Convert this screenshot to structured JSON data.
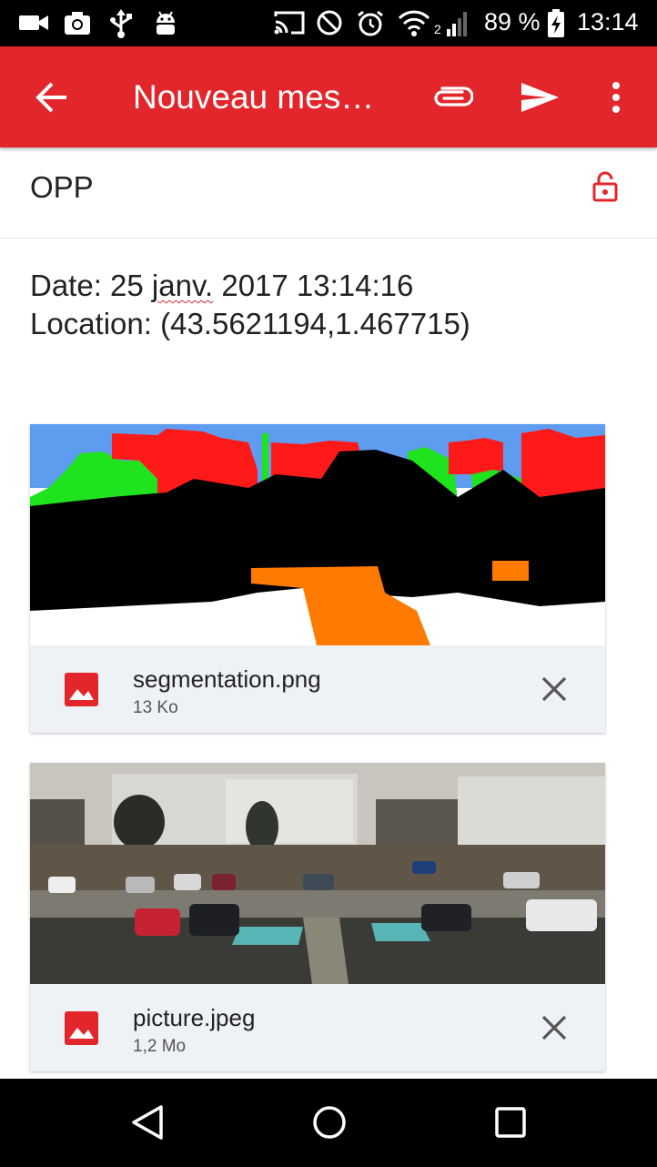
{
  "status_bar": {
    "network_label": "2",
    "battery": "89 %",
    "time": "13:14"
  },
  "app_bar": {
    "title": "Nouveau message",
    "icons": [
      "back-arrow-icon",
      "paperclip-icon",
      "send-icon",
      "more-vert-icon"
    ]
  },
  "recipient": {
    "text": "OPP"
  },
  "message": {
    "date_prefix": "Date: 25 ",
    "date_misspelled": "janv.",
    "date_suffix": " 2017 13:14:16",
    "location": "Location: (43.5621194,1.467715)"
  },
  "attachments": [
    {
      "name": "segmentation.png",
      "size": "13 Ko"
    },
    {
      "name": "picture.jpeg",
      "size": "1,2 Mo"
    }
  ],
  "colors": {
    "accent": "#e3262b",
    "footer": "#eef1f5"
  }
}
